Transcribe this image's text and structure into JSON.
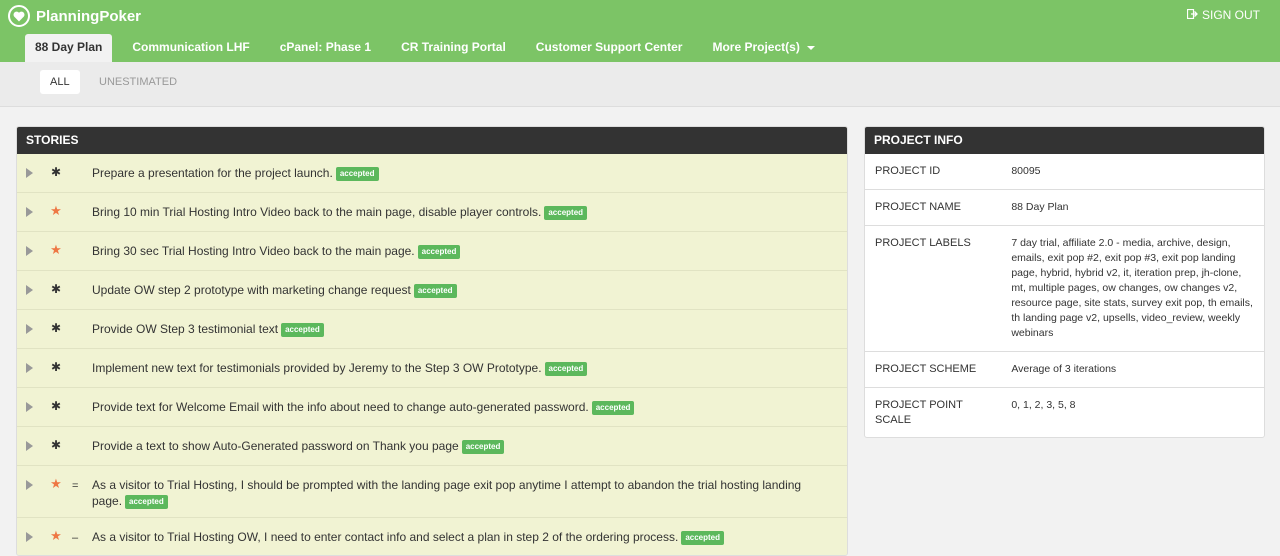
{
  "app": {
    "name": "PlanningPoker",
    "signout_label": "SIGN OUT"
  },
  "tabs": [
    {
      "label": "88 Day Plan",
      "active": true
    },
    {
      "label": "Communication LHF"
    },
    {
      "label": "cPanel: Phase 1"
    },
    {
      "label": "CR Training Portal"
    },
    {
      "label": "Customer Support Center"
    },
    {
      "label": "More Project(s)"
    }
  ],
  "filters": [
    {
      "label": "ALL",
      "active": true
    },
    {
      "label": "UNESTIMATED"
    }
  ],
  "stories": {
    "header": "STORIES",
    "items": [
      {
        "text": "Prepare a presentation for the project launch.",
        "status": "accepted",
        "type_icon": "gear"
      },
      {
        "text": "Bring 10 min Trial Hosting Intro Video back to the main page, disable player controls.",
        "status": "accepted",
        "type_icon": "star"
      },
      {
        "text": "Bring 30 sec Trial Hosting Intro Video back to the main page.",
        "status": "accepted",
        "type_icon": "star"
      },
      {
        "text": "Update OW step 2 prototype with marketing change request",
        "status": "accepted",
        "type_icon": "gear"
      },
      {
        "text": "Provide OW Step 3 testimonial text",
        "status": "accepted",
        "type_icon": "gear"
      },
      {
        "text": "Implement new text for testimonials provided by Jeremy to the Step 3 OW Prototype.",
        "status": "accepted",
        "type_icon": "gear"
      },
      {
        "text": "Provide text for Welcome Email with the info about need to change auto-generated password.",
        "status": "accepted",
        "type_icon": "gear"
      },
      {
        "text": "Provide a text to show Auto-Generated password on Thank you page",
        "status": "accepted",
        "type_icon": "gear"
      },
      {
        "text": "As a visitor to Trial Hosting, I should be prompted with the landing page exit pop anytime I attempt to abandon the trial hosting landing page.",
        "status": "accepted",
        "type_icon": "star",
        "priority": "="
      },
      {
        "text": "As a visitor to Trial Hosting OW, I need to enter contact info and select a plan in step 2 of the ordering process.",
        "status": "accepted",
        "type_icon": "star",
        "priority": "–"
      }
    ]
  },
  "project_info": {
    "header": "PROJECT INFO",
    "rows": [
      {
        "label": "PROJECT ID",
        "value": "80095"
      },
      {
        "label": "PROJECT NAME",
        "value": "88 Day Plan"
      },
      {
        "label": "PROJECT LABELS",
        "value": "7 day trial, affiliate 2.0 - media, archive, design, emails, exit pop #2, exit pop #3, exit pop landing page, hybrid, hybrid v2, it, iteration prep, jh-clone, mt, multiple pages, ow changes, ow changes v2, resource page, site stats, survey exit pop, th emails, th landing page v2, upsells, video_review, weekly webinars"
      },
      {
        "label": "PROJECT SCHEME",
        "value": "Average of 3 iterations"
      },
      {
        "label": "PROJECT POINT SCALE",
        "value": "0, 1, 2, 3, 5, 8"
      }
    ]
  },
  "colors": {
    "brand": "#7cc466",
    "accepted": "#5cb85c",
    "star": "#ee7744",
    "header": "#333333",
    "story_bg": "#f1f3d3"
  }
}
